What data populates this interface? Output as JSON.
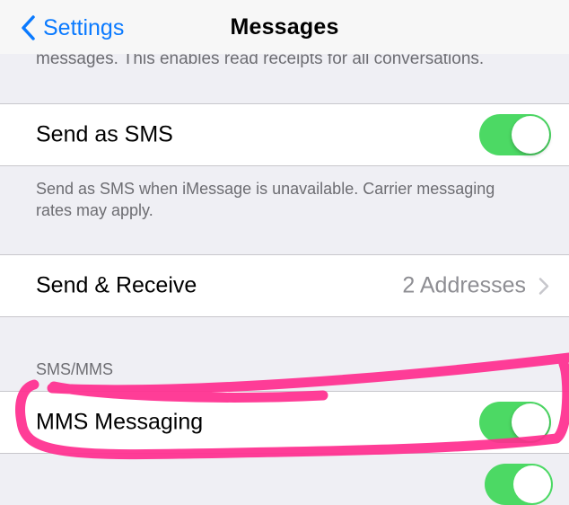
{
  "navbar": {
    "back_label": "Settings",
    "title": "Messages"
  },
  "top_cut_text": "messages. This enables read receipts for all conversations.",
  "send_as_sms": {
    "label": "Send as SMS",
    "toggle_on": true,
    "footer": "Send as SMS when iMessage is unavailable. Carrier messaging rates may apply."
  },
  "send_receive": {
    "label": "Send & Receive",
    "detail": "2 Addresses"
  },
  "sms_mms": {
    "header": "SMS/MMS",
    "mms_label": "MMS Messaging",
    "mms_toggle_on": true
  },
  "colors": {
    "accent_blue": "#0a7aff",
    "toggle_green": "#4cd964",
    "annotation_pink": "#ff2d8e"
  },
  "icons": [
    "chevron-left-icon",
    "chevron-right-icon"
  ]
}
